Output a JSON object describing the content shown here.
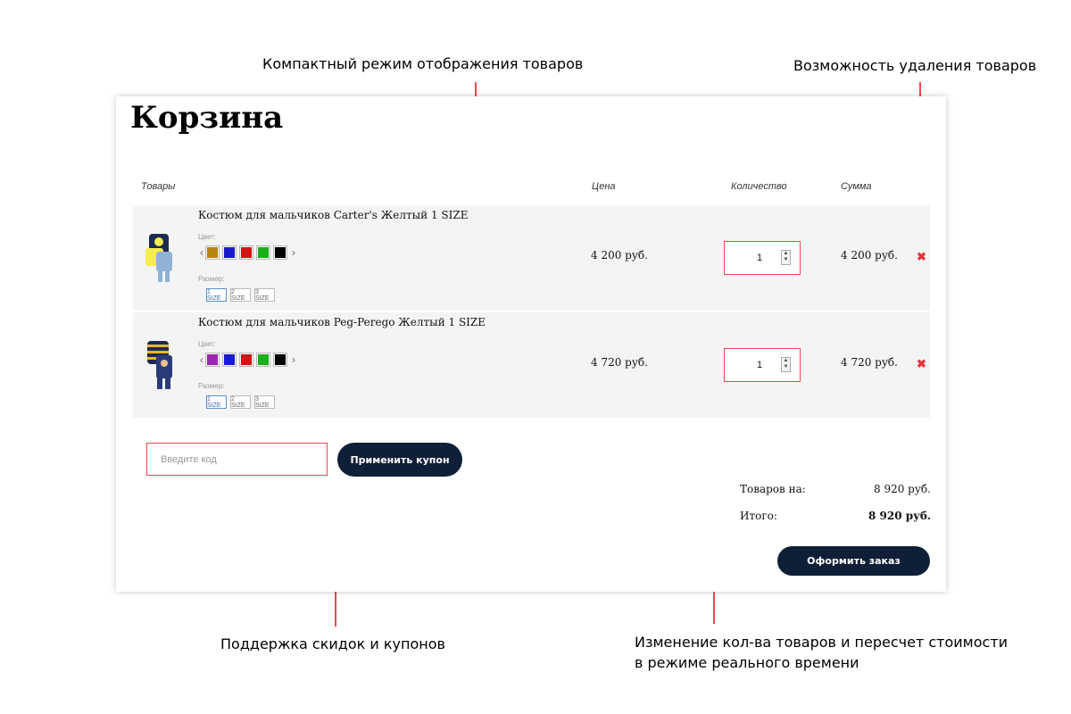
{
  "annotations": {
    "compact": "Компактный режим отображения товаров",
    "remove": "Возможность удаления товаров",
    "coupons": "Поддержка скидок и купонов",
    "realtime_line1": "Изменение кол-ва товаров и пересчет стоимости",
    "realtime_line2": "в режиме реального времени"
  },
  "cart": {
    "title": "Корзина",
    "headers": {
      "items": "Товары",
      "price": "Цена",
      "qty": "Количество",
      "sum": "Сумма"
    },
    "color_label": "Цвет:",
    "size_label": "Размер:",
    "sizes": [
      "1 SIZE",
      "2 SIZE",
      "3 SIZE"
    ],
    "remove_icon": "close-icon",
    "items": [
      {
        "name": "Костюм для мальчиков Carter's Желтый 1 SIZE",
        "colors": [
          "#b5860f",
          "#1a1acc",
          "#d11414",
          "#19b019",
          "#000000"
        ],
        "price": "4 200 руб.",
        "qty": "1",
        "sum": "4 200 руб."
      },
      {
        "name": "Костюм для мальчиков Peg-Perego Желтый 1 SIZE",
        "colors": [
          "#9c27b0",
          "#1a1acc",
          "#d11414",
          "#19b019",
          "#000000"
        ],
        "price": "4 720 руб.",
        "qty": "1",
        "sum": "4 720 руб."
      }
    ]
  },
  "coupon": {
    "placeholder": "Введите код",
    "button": "Применить купон"
  },
  "totals": {
    "items_label": "Товаров на:",
    "items_value": "8 920 руб.",
    "total_label": "Итого:",
    "total_value": "8 920 руб."
  },
  "checkout_button": "Оформить заказ",
  "accent_color": "#f0474f",
  "button_color": "#0f1f38"
}
